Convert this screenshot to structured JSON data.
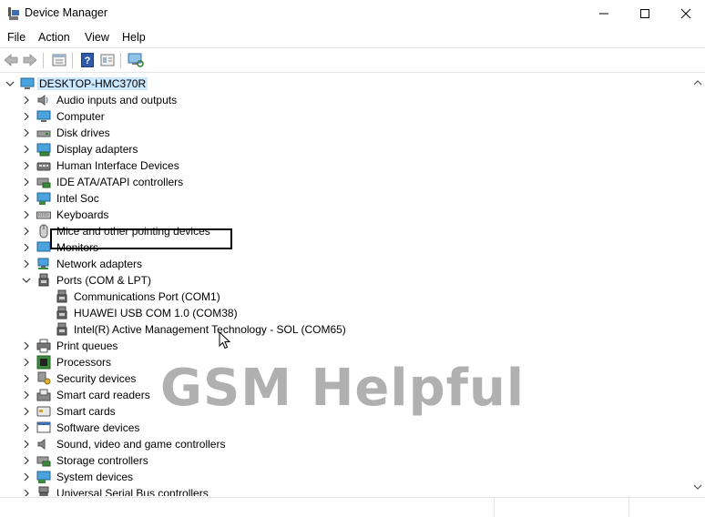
{
  "window": {
    "title": "Device Manager",
    "icon": "device-manager-icon",
    "controls": [
      "minimize-icon",
      "maximize-icon",
      "close-icon"
    ]
  },
  "menu": [
    "File",
    "Action",
    "View",
    "Help"
  ],
  "toolbar": [
    "back-icon",
    "forward-icon",
    "properties-icon",
    "help-icon",
    "show-hidden-icon",
    "scan-hardware-icon"
  ],
  "tree": {
    "root": "DESKTOP-HMC370R",
    "categories": [
      {
        "label": "Audio inputs and outputs",
        "icon": "speaker-icon",
        "expanded": false
      },
      {
        "label": "Computer",
        "icon": "computer-icon",
        "expanded": false
      },
      {
        "label": "Disk drives",
        "icon": "disk-drive-icon",
        "expanded": false
      },
      {
        "label": "Display adapters",
        "icon": "display-adapter-icon",
        "expanded": false
      },
      {
        "label": "Human Interface Devices",
        "icon": "hid-icon",
        "expanded": false
      },
      {
        "label": "IDE ATA/ATAPI controllers",
        "icon": "ide-controller-icon",
        "expanded": false
      },
      {
        "label": "Intel Soc",
        "icon": "intel-soc-icon",
        "expanded": false
      },
      {
        "label": "Keyboards",
        "icon": "keyboard-icon",
        "expanded": false
      },
      {
        "label": "Mice and other pointing devices",
        "icon": "mouse-icon",
        "expanded": false
      },
      {
        "label": "Monitors",
        "icon": "monitor-icon",
        "expanded": false
      },
      {
        "label": "Network adapters",
        "icon": "network-adapter-icon",
        "expanded": false
      },
      {
        "label": "Ports (COM & LPT)",
        "icon": "port-icon",
        "expanded": true,
        "children": [
          "Communications Port (COM1)",
          "HUAWEI USB COM 1.0 (COM38)",
          "Intel(R) Active Management Technology - SOL (COM65)"
        ]
      },
      {
        "label": "Print queues",
        "icon": "printer-icon",
        "expanded": false
      },
      {
        "label": "Processors",
        "icon": "processor-icon",
        "expanded": false
      },
      {
        "label": "Security devices",
        "icon": "security-device-icon",
        "expanded": false
      },
      {
        "label": "Smart card readers",
        "icon": "smart-card-reader-icon",
        "expanded": false
      },
      {
        "label": "Smart cards",
        "icon": "smart-card-icon",
        "expanded": false
      },
      {
        "label": "Software devices",
        "icon": "software-device-icon",
        "expanded": false
      },
      {
        "label": "Sound, video and game controllers",
        "icon": "sound-controller-icon",
        "expanded": false
      },
      {
        "label": "Storage controllers",
        "icon": "storage-controller-icon",
        "expanded": false
      },
      {
        "label": "System devices",
        "icon": "system-device-icon",
        "expanded": false
      },
      {
        "label": "Universal Serial Bus controllers",
        "icon": "usb-controller-icon",
        "expanded": false
      }
    ]
  },
  "watermark": "GSM Helpful",
  "colors": {
    "root_highlight": "#cce8ff",
    "selection_box": "#000000",
    "watermark": "#969696"
  }
}
